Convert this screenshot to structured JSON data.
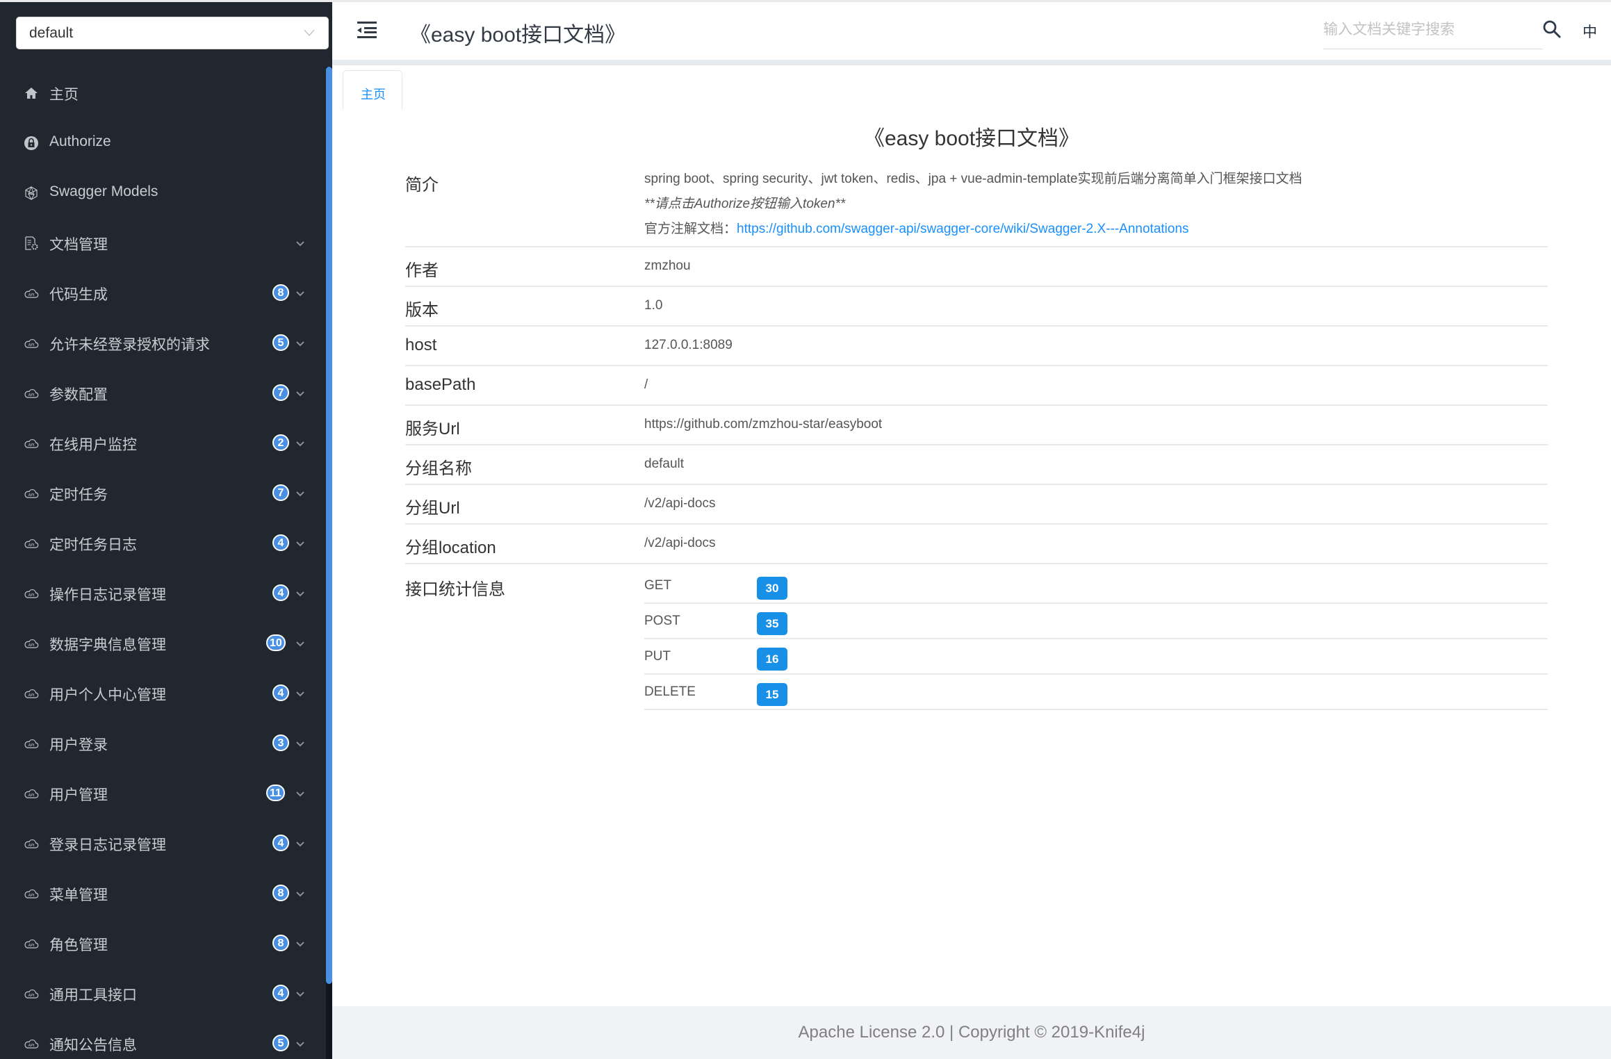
{
  "sidebar": {
    "group_select": {
      "value": "default"
    },
    "items": [
      {
        "label": "主页",
        "icon": "home-icon"
      },
      {
        "label": "Authorize",
        "icon": "lock-icon"
      },
      {
        "label": "Swagger Models",
        "icon": "cube-icon"
      },
      {
        "label": "文档管理",
        "icon": "document-gear-icon",
        "expandable": true
      },
      {
        "label": "代码生成",
        "icon": "api-cloud-icon",
        "count": "8"
      },
      {
        "label": "允许未经登录授权的请求",
        "icon": "api-cloud-icon",
        "count": "5"
      },
      {
        "label": "参数配置",
        "icon": "api-cloud-icon",
        "count": "7"
      },
      {
        "label": "在线用户监控",
        "icon": "api-cloud-icon",
        "count": "2"
      },
      {
        "label": "定时任务",
        "icon": "api-cloud-icon",
        "count": "7"
      },
      {
        "label": "定时任务日志",
        "icon": "api-cloud-icon",
        "count": "4"
      },
      {
        "label": "操作日志记录管理",
        "icon": "api-cloud-icon",
        "count": "4"
      },
      {
        "label": "数据字典信息管理",
        "icon": "api-cloud-icon",
        "count": "10"
      },
      {
        "label": "用户个人中心管理",
        "icon": "api-cloud-icon",
        "count": "4"
      },
      {
        "label": "用户登录",
        "icon": "api-cloud-icon",
        "count": "3"
      },
      {
        "label": "用户管理",
        "icon": "api-cloud-icon",
        "count": "11"
      },
      {
        "label": "登录日志记录管理",
        "icon": "api-cloud-icon",
        "count": "4"
      },
      {
        "label": "菜单管理",
        "icon": "api-cloud-icon",
        "count": "8"
      },
      {
        "label": "角色管理",
        "icon": "api-cloud-icon",
        "count": "8"
      },
      {
        "label": "通用工具接口",
        "icon": "api-cloud-icon",
        "count": "4"
      },
      {
        "label": "通知公告信息",
        "icon": "api-cloud-icon",
        "count": "5"
      }
    ]
  },
  "header": {
    "title": "《easy boot接口文档》",
    "search_placeholder": "输入文档关键字搜索",
    "search_value": "",
    "lang_label": "中"
  },
  "tabs": [
    {
      "label": "主页",
      "active": true
    }
  ],
  "doc": {
    "title": "《easy boot接口文档》",
    "intro": {
      "key": "简介",
      "line1": "spring boot、spring security、jwt token、redis、jpa + vue-admin-template实现前后端分离简单入门框架接口文档",
      "line2": "**请点击Authorize按钮输入token**",
      "line3_prefix": "官方注解文档：",
      "line3_link": "https://github.com/swagger-api/swagger-core/wiki/Swagger-2.X---Annotations"
    },
    "rows": [
      {
        "key": "作者",
        "value": "zmzhou"
      },
      {
        "key": "版本",
        "value": "1.0"
      },
      {
        "key": "host",
        "value": "127.0.0.1:8089"
      },
      {
        "key": "basePath",
        "value": "/"
      },
      {
        "key": "服务Url",
        "value": "https://github.com/zmzhou-star/easyboot"
      },
      {
        "key": "分组名称",
        "value": "default"
      },
      {
        "key": "分组Url",
        "value": "/v2/api-docs"
      },
      {
        "key": "分组location",
        "value": "/v2/api-docs"
      }
    ],
    "stats": {
      "key": "接口统计信息",
      "items": [
        {
          "method": "GET",
          "count": "30"
        },
        {
          "method": "POST",
          "count": "35"
        },
        {
          "method": "PUT",
          "count": "16"
        },
        {
          "method": "DELETE",
          "count": "15"
        }
      ]
    }
  },
  "footer": {
    "text": "Apache License 2.0 | Copyright © 2019-Knife4j"
  },
  "colors": {
    "accent": "#1890ff",
    "badge": "#4a90e2",
    "sidebar_bg": "#20272e",
    "count_badge": "#1890e8"
  }
}
